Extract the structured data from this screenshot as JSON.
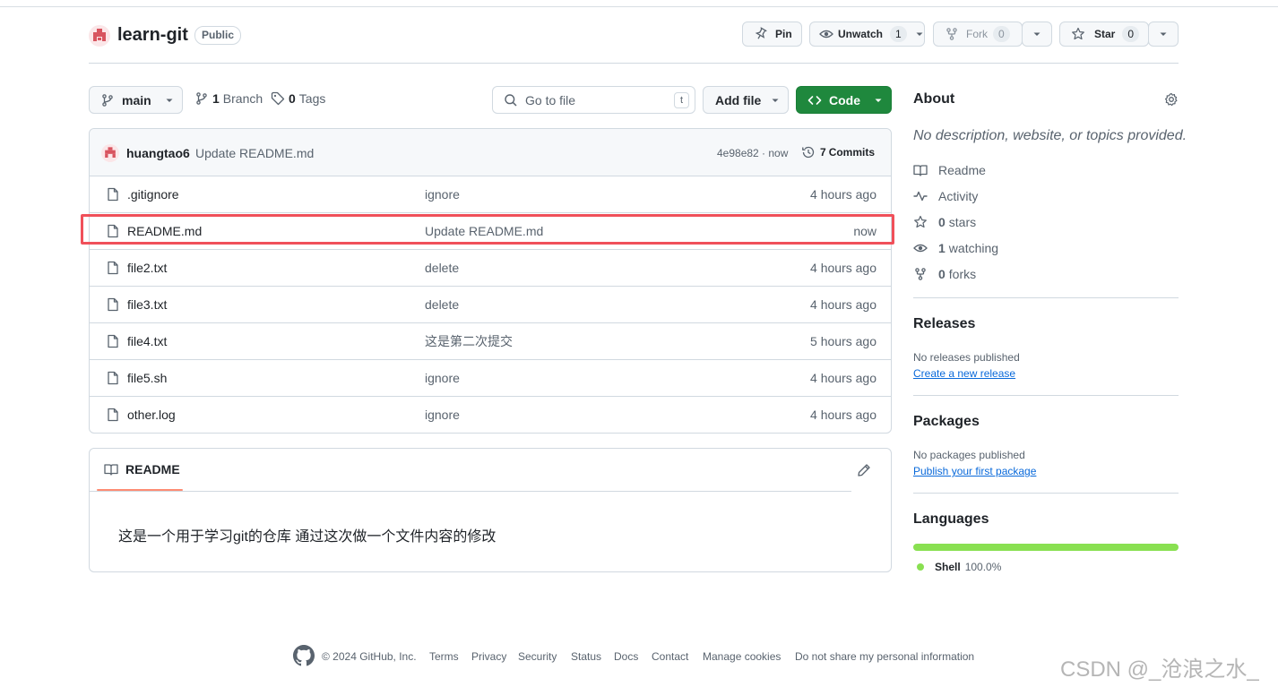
{
  "repo": {
    "name": "learn-git",
    "visibility": "Public"
  },
  "actions": {
    "pin": "Pin",
    "unwatch": "Unwatch",
    "unwatch_count": "1",
    "fork": "Fork",
    "fork_count": "0",
    "star": "Star",
    "star_count": "0"
  },
  "toolbar": {
    "branch": "main",
    "branches_count": "1",
    "branches_label": "Branch",
    "tags_count": "0",
    "tags_label": "Tags",
    "search_placeholder": "Go to file",
    "search_kbd": "t",
    "add_file": "Add file",
    "code": "Code"
  },
  "commit": {
    "author": "huangtao6",
    "message": "Update README.md",
    "hash_time": "4e98e82 · now",
    "commits_count": "7",
    "commits_label": "Commits"
  },
  "files": [
    {
      "name": ".gitignore",
      "message": "ignore",
      "time": "4 hours ago"
    },
    {
      "name": "README.md",
      "message": "Update README.md",
      "time": "now"
    },
    {
      "name": "file2.txt",
      "message": "delete",
      "time": "4 hours ago"
    },
    {
      "name": "file3.txt",
      "message": "delete",
      "time": "4 hours ago"
    },
    {
      "name": "file4.txt",
      "message": "这是第二次提交",
      "time": "5 hours ago"
    },
    {
      "name": "file5.sh",
      "message": "ignore",
      "time": "4 hours ago"
    },
    {
      "name": "other.log",
      "message": "ignore",
      "time": "4 hours ago"
    }
  ],
  "readme": {
    "tab": "README",
    "content": "这是一个用于学习git的仓库 通过这次做一个文件内容的修改"
  },
  "about": {
    "title": "About",
    "description": "No description, website, or topics provided.",
    "readme": "Readme",
    "activity": "Activity",
    "stars_count": "0",
    "stars_label": "stars",
    "watching_count": "1",
    "watching_label": "watching",
    "forks_count": "0",
    "forks_label": "forks"
  },
  "releases": {
    "title": "Releases",
    "empty": "No releases published",
    "link": "Create a new release"
  },
  "packages": {
    "title": "Packages",
    "empty": "No packages published",
    "link": "Publish your first package"
  },
  "languages": {
    "title": "Languages",
    "items": [
      {
        "name": "Shell",
        "percent": "100.0%",
        "color": "#89e051"
      }
    ]
  },
  "footer": {
    "copyright": "© 2024 GitHub, Inc.",
    "links": [
      "Terms",
      "Privacy",
      "Security",
      "Status",
      "Docs",
      "Contact",
      "Manage cookies",
      "Do not share my personal information"
    ]
  },
  "watermark": "CSDN @_沧浪之水_",
  "colors": {
    "highlight": "#f0505a",
    "primary": "#1f883d",
    "accent_underline": "#fd8c73"
  }
}
